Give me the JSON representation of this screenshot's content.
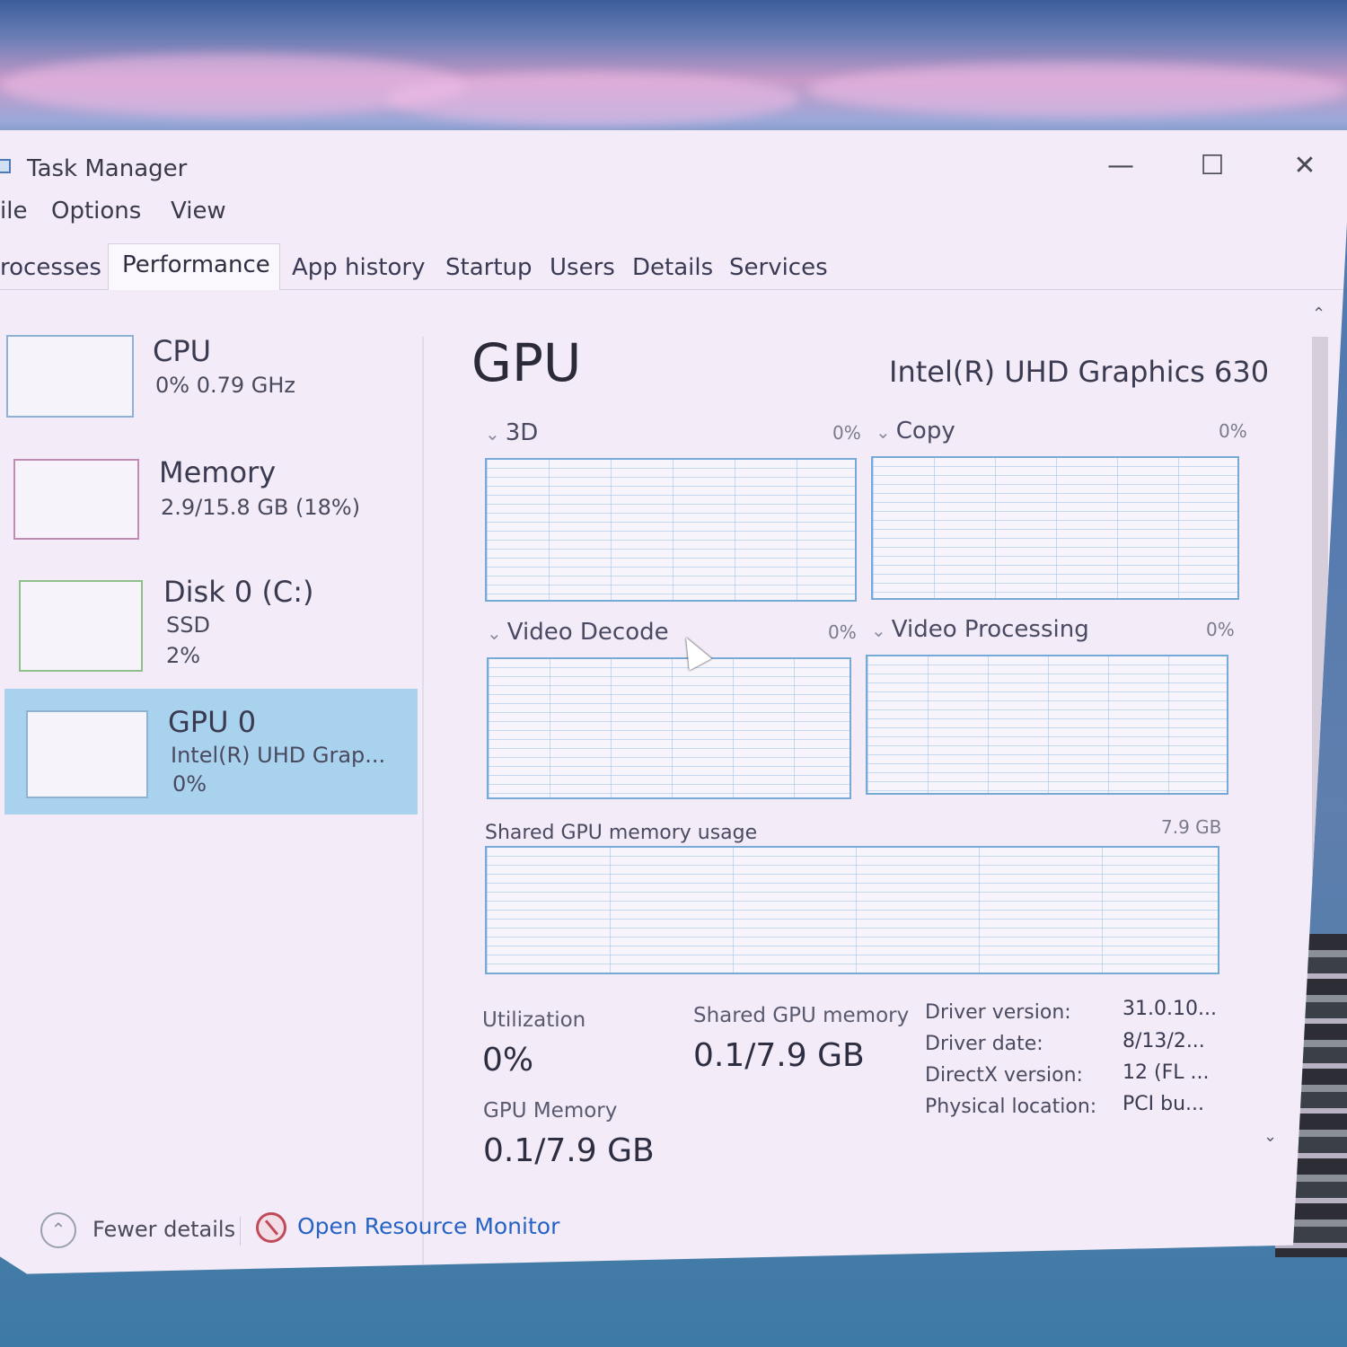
{
  "window": {
    "title": "Task Manager",
    "controls": {
      "minimize": "—",
      "maximize": "☐",
      "close": "✕"
    }
  },
  "menu": [
    "ile",
    "Options",
    "View"
  ],
  "tabs": [
    "rocesses",
    "Performance",
    "App history",
    "Startup",
    "Users",
    "Details",
    "Services"
  ],
  "active_tab": "Performance",
  "sidebar": [
    {
      "title": "CPU",
      "line1": "0% 0.79 GHz",
      "line2": ""
    },
    {
      "title": "Memory",
      "line1": "2.9/15.8 GB (18%)",
      "line2": ""
    },
    {
      "title": "Disk 0 (C:)",
      "line1": "SSD",
      "line2": "2%"
    },
    {
      "title": "GPU 0",
      "line1": "Intel(R) UHD Grap...",
      "line2": "0%"
    }
  ],
  "selected_sidebar": "GPU 0",
  "detail": {
    "title": "GPU",
    "model": "Intel(R) UHD Graphics 630",
    "graphs": [
      {
        "label": "3D",
        "percent": "0%"
      },
      {
        "label": "Copy",
        "percent": "0%"
      },
      {
        "label": "Video Decode",
        "percent": "0%"
      },
      {
        "label": "Video Processing",
        "percent": "0%"
      }
    ],
    "shared_graph": {
      "label": "Shared GPU memory usage",
      "max": "7.9 GB"
    },
    "stats": {
      "utilization_label": "Utilization",
      "utilization_value": "0%",
      "shared_label": "Shared GPU memory",
      "shared_value": "0.1/7.9 GB",
      "gpu_memory_label": "GPU Memory",
      "gpu_memory_value": "0.1/7.9 GB"
    },
    "info": [
      {
        "key": "Driver version:",
        "value": "31.0.10..."
      },
      {
        "key": "Driver date:",
        "value": "8/13/2..."
      },
      {
        "key": "DirectX version:",
        "value": "12 (FL ..."
      },
      {
        "key": "Physical location:",
        "value": "PCI bu..."
      }
    ]
  },
  "footer": {
    "fewer_details": "Fewer details",
    "open_resource_monitor": "Open Resource Monitor"
  },
  "colors": {
    "accent_link": "#2563c4",
    "graph_border": "#76aad6",
    "selected_bg": "#a9d2ef"
  }
}
